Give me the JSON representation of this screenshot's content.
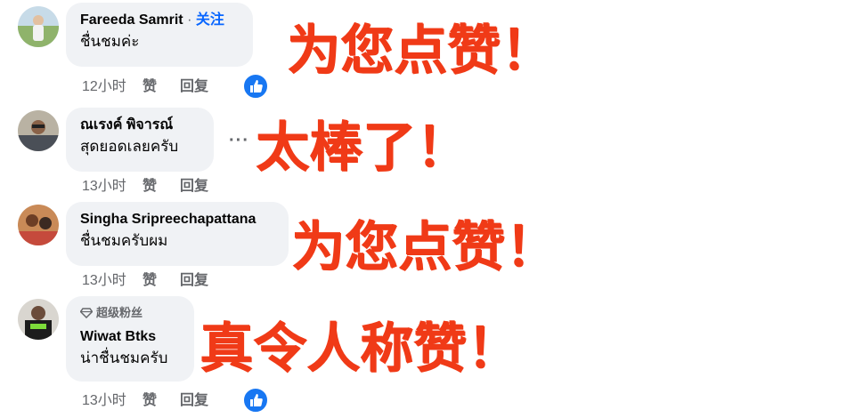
{
  "comments": [
    {
      "name": "Fareeda Samrit",
      "separator": "·",
      "follow_label": "关注",
      "text": "ชื่นชมค่ะ",
      "time": "12小时",
      "like_label": "赞",
      "reply_label": "回复",
      "caption": "为您点赞！",
      "has_like_reaction": true
    },
    {
      "name": "ณเรงค์ พิจารณ์",
      "text": "สุดยอดเลยครับ",
      "time": "13小时",
      "like_label": "赞",
      "reply_label": "回复",
      "more_label": "···",
      "caption": "太棒了！"
    },
    {
      "name": "Singha Sripreechapattana",
      "text": "ชื่นชมครับผม",
      "time": "13小时",
      "like_label": "赞",
      "reply_label": "回复",
      "caption": "为您点赞！"
    },
    {
      "badge": "超级粉丝",
      "name": "Wiwat Btks",
      "text": "น่าชื่นชมครับ",
      "time": "13小时",
      "like_label": "赞",
      "reply_label": "回复",
      "caption": "真令人称赞！",
      "has_like_reaction": true
    }
  ],
  "colors": {
    "caption": "#f03a17",
    "link_blue": "#0866ff",
    "bubble_bg": "#f0f2f5",
    "meta_gray": "#65676b",
    "like_blue": "#1877f2"
  }
}
